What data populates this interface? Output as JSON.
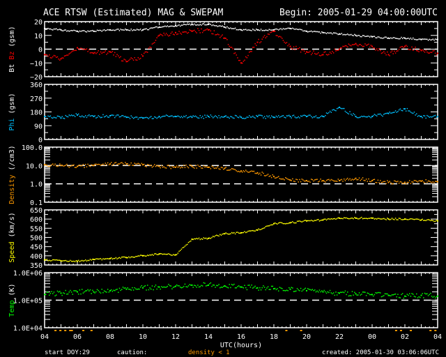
{
  "chart_data": {
    "type": "scatter",
    "title": "ACE RTSW (Estimated) MAG & SWEPAM",
    "begin_label": "Begin: 2005-01-29 04:00:00UTC",
    "xlabel": "UTC(hours)",
    "x_tick_labels": [
      "04",
      "06",
      "08",
      "10",
      "12",
      "14",
      "16",
      "18",
      "20",
      "22",
      "00",
      "02",
      "04"
    ],
    "x_hours": [
      0,
      1,
      2,
      3,
      4,
      5,
      6,
      7,
      8,
      9,
      10,
      11,
      12,
      13,
      14,
      15,
      16,
      17,
      18,
      19,
      20,
      21,
      22,
      23,
      24
    ],
    "panels": [
      {
        "ylabel_parts": [
          {
            "text": "Bt",
            "color": "#ffffff"
          },
          {
            "text": "Bz",
            "color": "#ff0000"
          },
          {
            "text": "(gsm)",
            "color": "#ffffff"
          }
        ],
        "scale": "linear",
        "ylim": [
          -20,
          20
        ],
        "y_ticks": [
          {
            "v": 20,
            "label": "20"
          },
          {
            "v": 10,
            "label": "10"
          },
          {
            "v": 0,
            "label": "0"
          },
          {
            "v": -10,
            "label": "−10"
          },
          {
            "v": -20,
            "label": "−20"
          }
        ],
        "dashed_lines": [
          0
        ],
        "series": [
          {
            "name": "Bt",
            "color": "#ffffff",
            "values": [
              15,
              14,
              13,
              13,
              14,
              14,
              14,
              16,
              17,
              18,
              18,
              16,
              14,
              14,
              14,
              15,
              13,
              12,
              11,
              10,
              9,
              8,
              8,
              7,
              7
            ]
          },
          {
            "name": "Bz",
            "color": "#ff0000",
            "values": [
              -4,
              -7,
              1,
              -3,
              -2,
              -9,
              -5,
              10,
              12,
              13,
              14,
              8,
              -10,
              5,
              13,
              2,
              -2,
              -4,
              0,
              4,
              2,
              -4,
              2,
              -1,
              -3
            ]
          }
        ]
      },
      {
        "ylabel_parts": [
          {
            "text": "Phi",
            "color": "#00c0ff"
          },
          {
            "text": "(gsm)",
            "color": "#ffffff"
          }
        ],
        "scale": "linear",
        "ylim": [
          0,
          360
        ],
        "y_ticks": [
          {
            "v": 360,
            "label": "360"
          },
          {
            "v": 270,
            "label": "270"
          },
          {
            "v": 180,
            "label": "180"
          },
          {
            "v": 90,
            "label": "90"
          },
          {
            "v": 0,
            "label": "0"
          }
        ],
        "dashed_lines": [],
        "series": [
          {
            "name": "Phi",
            "color": "#00c0ff",
            "values": [
              150,
              140,
              160,
              150,
              155,
              145,
              140,
              150,
              150,
              145,
              150,
              150,
              145,
              150,
              145,
              150,
              150,
              150,
              210,
              150,
              150,
              170,
              200,
              150,
              150
            ]
          }
        ]
      },
      {
        "ylabel_parts": [
          {
            "text": "Density",
            "color": "#ff9900"
          },
          {
            "text": "(/cm3)",
            "color": "#ffffff"
          }
        ],
        "scale": "log",
        "ylim": [
          0.1,
          100
        ],
        "y_ticks": [
          {
            "v": 100,
            "label": "100.0"
          },
          {
            "v": 10,
            "label": "10.0"
          },
          {
            "v": 1,
            "label": "1.0"
          },
          {
            "v": 0.1,
            "label": "0.1"
          }
        ],
        "dashed_lines": [
          10,
          1
        ],
        "series": [
          {
            "name": "Density",
            "color": "#ff9900",
            "values": [
              11,
              10,
              9,
              10,
              12,
              12,
              11,
              9,
              8,
              9,
              8,
              7,
              5,
              4,
              2.5,
              1.6,
              1.5,
              1.5,
              1.5,
              2,
              1.5,
              1.2,
              1.2,
              1.4,
              1.3
            ]
          }
        ]
      },
      {
        "ylabel_parts": [
          {
            "text": "Speed",
            "color": "#ffff00"
          },
          {
            "text": "(km/s)",
            "color": "#ffffff"
          }
        ],
        "scale": "linear",
        "ylim": [
          350,
          650
        ],
        "y_ticks": [
          {
            "v": 650,
            "label": "650"
          },
          {
            "v": 600,
            "label": "600"
          },
          {
            "v": 550,
            "label": "550"
          },
          {
            "v": 500,
            "label": "500"
          },
          {
            "v": 450,
            "label": "450"
          },
          {
            "v": 400,
            "label": "400"
          },
          {
            "v": 350,
            "label": "350"
          }
        ],
        "dashed_lines": [],
        "series": [
          {
            "name": "Speed",
            "color": "#ffff00",
            "values": [
              378,
              372,
              370,
              380,
              385,
              390,
              400,
              410,
              405,
              490,
              495,
              520,
              525,
              540,
              575,
              580,
              590,
              595,
              605,
              605,
              605,
              600,
              600,
              595,
              590
            ]
          }
        ]
      },
      {
        "ylabel_parts": [
          {
            "text": "Temp",
            "color": "#00ff00"
          },
          {
            "text": "(K)",
            "color": "#ffffff"
          }
        ],
        "scale": "log",
        "ylim": [
          10000,
          1000000
        ],
        "y_ticks": [
          {
            "v": 1000000,
            "label": "1.0E+06"
          },
          {
            "v": 100000,
            "label": "1.0E+05"
          },
          {
            "v": 10000,
            "label": "1.0E+04"
          }
        ],
        "dashed_lines": [
          100000
        ],
        "series": [
          {
            "name": "Temp",
            "color": "#00ff00",
            "values": [
              160000,
              180000,
              200000,
              200000,
              220000,
              250000,
              280000,
              300000,
              320000,
              350000,
              350000,
              330000,
              300000,
              280000,
              260000,
              250000,
              220000,
              200000,
              180000,
              170000,
              160000,
              150000,
              140000,
              150000,
              140000
            ]
          }
        ]
      }
    ],
    "density_warning_hours": [
      1.5,
      14.7,
      15.6,
      21.4,
      21.7,
      22.3,
      23.5,
      23.8,
      24.6,
      24.9,
      25.2,
      25.6,
      26.3,
      26.8
    ]
  },
  "footer": {
    "start_doy_label": "start DOY:",
    "start_doy": "29",
    "caution_label": "caution:",
    "caution_text": "density < 1",
    "caution_color": "#ff9900",
    "created": "created: 2005-01-30 03:06:06UTC"
  }
}
